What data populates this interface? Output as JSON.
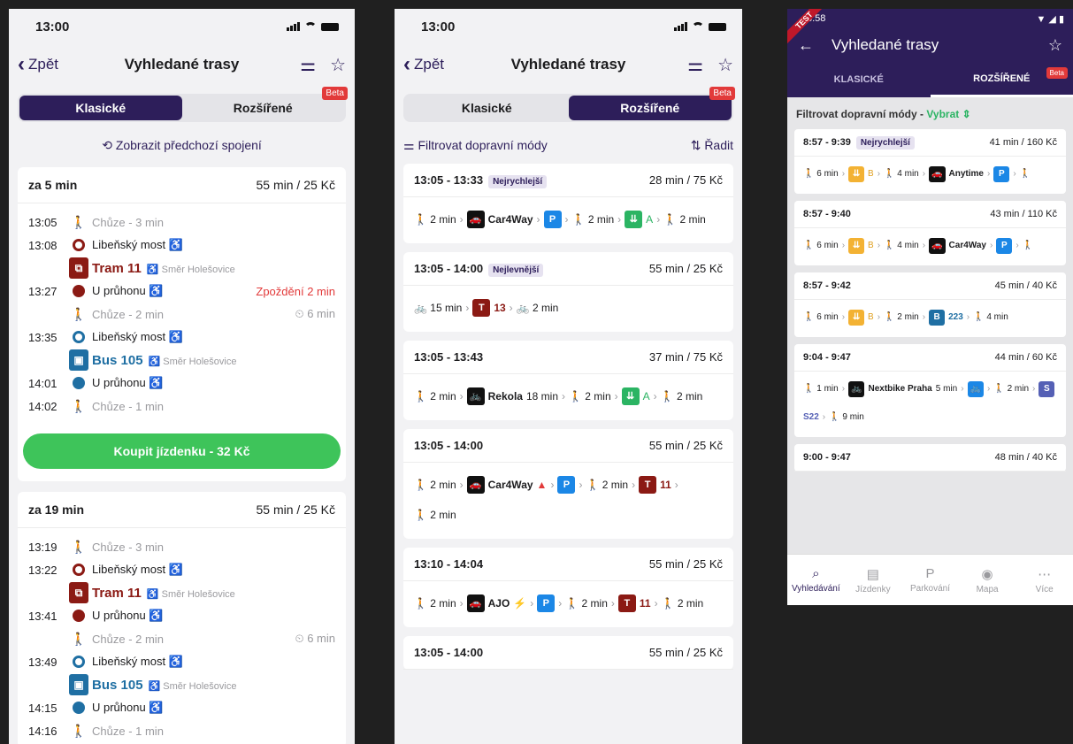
{
  "common": {
    "time": "13:00",
    "back": "Zpět",
    "title": "Vyhledané trasy",
    "tab_classic": "Klasické",
    "tab_extended": "Rozšířené",
    "beta": "Beta",
    "filter_icon": "filter-icon",
    "star_icon": "star-icon"
  },
  "screen1": {
    "prev_link": "Zobrazit předchozí spojení",
    "cards": [
      {
        "head": "za 5 min",
        "summary": "55 min / 25 Kč",
        "rows": [
          {
            "t": "13:05",
            "kind": "walk",
            "text": "Chůze - 3 min"
          },
          {
            "t": "13:08",
            "kind": "stop-open-tram",
            "text": "Libeňský most ♿"
          },
          {
            "t": "",
            "kind": "tram",
            "line": "Tram 11",
            "sub": "Směr Holešovice"
          },
          {
            "t": "13:27",
            "kind": "stop-fill-tram",
            "text": "U průhonu ♿",
            "extra": "Zpoždění 2 min"
          },
          {
            "t": "",
            "kind": "walk",
            "text": "Chůze - 2 min",
            "wait": "6 min"
          },
          {
            "t": "13:35",
            "kind": "stop-open-bus",
            "text": "Libeňský most ♿"
          },
          {
            "t": "",
            "kind": "bus",
            "line": "Bus 105",
            "sub": "Směr Holešovice"
          },
          {
            "t": "14:01",
            "kind": "stop-fill-bus",
            "text": "U průhonu ♿"
          },
          {
            "t": "14:02",
            "kind": "walk",
            "text": "Chůze - 1 min"
          }
        ],
        "buy": "Koupit jízdenku - 32 Kč"
      },
      {
        "head": "za 19 min",
        "summary": "55 min / 25 Kč",
        "rows": [
          {
            "t": "13:19",
            "kind": "walk",
            "text": "Chůze - 3 min"
          },
          {
            "t": "13:22",
            "kind": "stop-open-tram",
            "text": "Libeňský most ♿"
          },
          {
            "t": "",
            "kind": "tram",
            "line": "Tram 11",
            "sub": "Směr Holešovice"
          },
          {
            "t": "13:41",
            "kind": "stop-fill-tram",
            "text": "U průhonu ♿"
          },
          {
            "t": "",
            "kind": "walk",
            "text": "Chůze - 2 min",
            "wait": "6 min"
          },
          {
            "t": "13:49",
            "kind": "stop-open-bus",
            "text": "Libeňský most ♿"
          },
          {
            "t": "",
            "kind": "bus",
            "line": "Bus 105",
            "sub": "Směr Holešovice"
          },
          {
            "t": "14:15",
            "kind": "stop-fill-bus",
            "text": "U průhonu ♿"
          },
          {
            "t": "14:16",
            "kind": "walk",
            "text": "Chůze - 1 min"
          }
        ]
      }
    ]
  },
  "screen2": {
    "filter": "Filtrovat dopravní módy",
    "sort": "Řadit",
    "cards": [
      {
        "time": "13:05 - 13:33",
        "tag": "Nejrychlejší",
        "summary": "28 min / 75 Kč",
        "route": [
          [
            "w",
            "2 min"
          ],
          [
            ">"
          ],
          [
            "chip-black",
            "🚗"
          ],
          [
            "b",
            "Car4Way"
          ],
          [
            ">"
          ],
          [
            "chip-blue",
            "P"
          ],
          [
            ">"
          ],
          [
            "w",
            "2 min"
          ],
          [
            ">"
          ],
          [
            "chip-green",
            "⇊"
          ],
          [
            "g",
            "A"
          ],
          [
            ">"
          ],
          [
            "w",
            "2 min"
          ]
        ]
      },
      {
        "time": "13:05 - 14:00",
        "tag": "Nejlevnější",
        "summary": "55 min / 25 Kč",
        "route": [
          [
            "bike",
            "15 min"
          ],
          [
            ">"
          ],
          [
            "chip-tram",
            "T"
          ],
          [
            "tr",
            "13"
          ],
          [
            ">"
          ],
          [
            "bike",
            "2 min"
          ]
        ]
      },
      {
        "time": "13:05 - 13:43",
        "tag": "",
        "summary": "37 min / 75 Kč",
        "route": [
          [
            "w",
            "2 min"
          ],
          [
            ">"
          ],
          [
            "chip-black",
            "🚲"
          ],
          [
            "b",
            "Rekola"
          ],
          [
            "t",
            "18 min"
          ],
          [
            ">"
          ],
          [
            "w",
            "2 min"
          ],
          [
            ">"
          ],
          [
            "chip-green",
            "⇊"
          ],
          [
            "g",
            "A"
          ],
          [
            ">"
          ],
          [
            "w",
            "2 min"
          ]
        ]
      },
      {
        "time": "13:05 - 14:00",
        "tag": "",
        "summary": "55 min / 25 Kč",
        "route": [
          [
            "w",
            "2 min"
          ],
          [
            ">"
          ],
          [
            "chip-black",
            "🚗"
          ],
          [
            "b",
            "Car4Way"
          ],
          [
            "warn",
            "▲"
          ],
          [
            ">"
          ],
          [
            "chip-blue",
            "P"
          ],
          [
            ">"
          ],
          [
            "w",
            "2 min"
          ],
          [
            ">"
          ],
          [
            "chip-tram",
            "T"
          ],
          [
            "tr",
            "11"
          ],
          [
            ">"
          ],
          [
            "w",
            "2 min"
          ]
        ]
      },
      {
        "time": "13:10 - 14:04",
        "tag": "",
        "summary": "55 min / 25 Kč",
        "route": [
          [
            "w",
            "2 min"
          ],
          [
            ">"
          ],
          [
            "chip-black",
            "🚗"
          ],
          [
            "b",
            "AJO"
          ],
          [
            "bolt",
            "⚡"
          ],
          [
            ">"
          ],
          [
            "chip-blue",
            "P"
          ],
          [
            ">"
          ],
          [
            "w",
            "2 min"
          ],
          [
            ">"
          ],
          [
            "chip-tram",
            "T"
          ],
          [
            "tr",
            "11"
          ],
          [
            ">"
          ],
          [
            "w",
            "2 min"
          ]
        ]
      },
      {
        "time": "13:05 - 14:00",
        "tag": "",
        "summary": "55 min / 25 Kč",
        "route": []
      }
    ]
  },
  "screen3": {
    "status_time": "8:58",
    "test": "TEST",
    "tab_classic": "KLASICKÉ",
    "tab_extended": "ROZŠÍŘENÉ",
    "filter": "Filtrovat dopravní módy -",
    "filter_link": "Vybrat",
    "cards": [
      {
        "time": "8:57 - 9:39",
        "tag": "Nejrychlejší",
        "summary": "41 min / 160 Kč",
        "route": [
          [
            "w",
            "6 min"
          ],
          [
            ">"
          ],
          [
            "chip-orange",
            "⇊"
          ],
          [
            "o",
            "B"
          ],
          [
            ">"
          ],
          [
            "w",
            "4 min"
          ],
          [
            ">"
          ],
          [
            "chip-black",
            "🚗"
          ],
          [
            "b",
            "Anytime"
          ],
          [
            ">"
          ],
          [
            "chip-blue",
            "P"
          ],
          [
            ">"
          ],
          [
            "w",
            ""
          ]
        ]
      },
      {
        "time": "8:57 - 9:40",
        "tag": "",
        "summary": "43 min / 110 Kč",
        "route": [
          [
            "w",
            "6 min"
          ],
          [
            ">"
          ],
          [
            "chip-orange",
            "⇊"
          ],
          [
            "o",
            "B"
          ],
          [
            ">"
          ],
          [
            "w",
            "4 min"
          ],
          [
            ">"
          ],
          [
            "chip-black",
            "🚗"
          ],
          [
            "b",
            "Car4Way"
          ],
          [
            ">"
          ],
          [
            "chip-blue",
            "P"
          ],
          [
            ">"
          ],
          [
            "w",
            ""
          ]
        ]
      },
      {
        "time": "8:57 - 9:42",
        "tag": "",
        "summary": "45 min / 40 Kč",
        "route": [
          [
            "w",
            "6 min"
          ],
          [
            ">"
          ],
          [
            "chip-orange",
            "⇊"
          ],
          [
            "o",
            "B"
          ],
          [
            ">"
          ],
          [
            "w",
            "2 min"
          ],
          [
            ">"
          ],
          [
            "chip-bus",
            "B"
          ],
          [
            "bu",
            "223"
          ],
          [
            ">"
          ],
          [
            "w",
            "4 min"
          ]
        ]
      },
      {
        "time": "9:04 - 9:47",
        "tag": "",
        "summary": "44 min / 60 Kč",
        "route": [
          [
            "w",
            "1 min"
          ],
          [
            ">"
          ],
          [
            "chip-black",
            "🚲"
          ],
          [
            "b",
            "Nextbike Praha"
          ],
          [
            "t",
            "5 min"
          ],
          [
            ">"
          ],
          [
            "chip-blue",
            "🚲"
          ],
          [
            ">"
          ],
          [
            "w",
            "2 min"
          ],
          [
            ">"
          ],
          [
            "chip-s",
            "S"
          ],
          [
            "s",
            "S22"
          ],
          [
            ">"
          ],
          [
            "w",
            "9 min"
          ]
        ]
      },
      {
        "time": "9:00 - 9:47",
        "tag": "",
        "summary": "48 min / 40 Kč",
        "route": []
      }
    ],
    "nav": [
      "Vyhledávání",
      "Jízdenky",
      "Parkování",
      "Mapa",
      "Více"
    ]
  }
}
